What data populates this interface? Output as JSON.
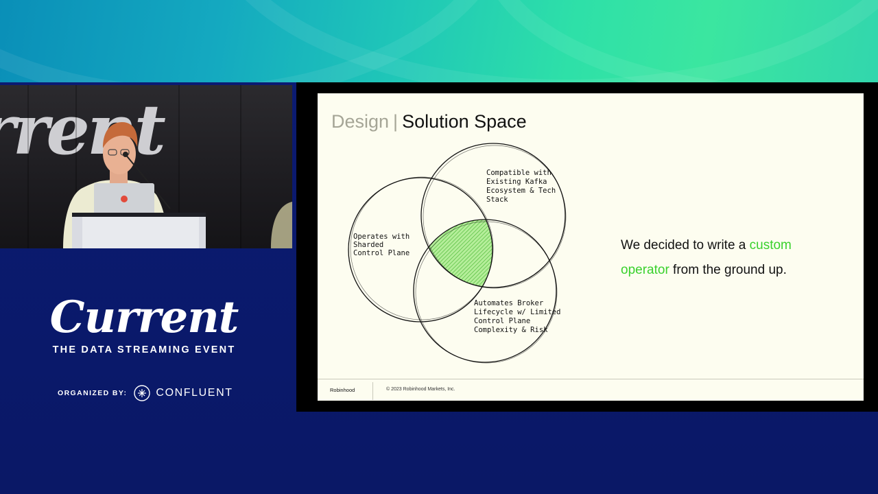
{
  "event": {
    "logo_text": "Current",
    "tagline": "THE DATA STREAMING EVENT",
    "organized_by_label": "ORGANIZED BY:",
    "organizer_name": "CONFLUENT",
    "backdrop_text": "rrent"
  },
  "slide": {
    "title_section": "Design",
    "title_separator": "|",
    "title_main": "Solution Space",
    "venn": {
      "circle_top_label": [
        "Compatible with",
        "Existing Kafka",
        "Ecosystem & Tech",
        "Stack"
      ],
      "circle_left_label": [
        "Operates with",
        "Sharded",
        "Control Plane"
      ],
      "circle_bottom_label": [
        "Automates Broker",
        "Lifecycle w/ Limited",
        "Control Plane",
        "Complexity & Risk"
      ]
    },
    "statement": {
      "before": "We decided to write a ",
      "accent": "custom operator",
      "after": " from the ground up."
    },
    "footer": {
      "brand": "Robinhood",
      "copyright": "© 2023 Robinhood Markets, Inc."
    }
  },
  "colors": {
    "accent_green": "#39d12c",
    "navy": "#0a1a6e",
    "slide_bg": "#fdfdf0"
  }
}
